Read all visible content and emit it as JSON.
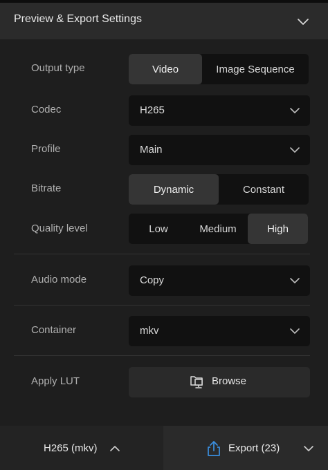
{
  "header": {
    "title": "Preview & Export Settings",
    "chevron_icon": "chevron-down-icon"
  },
  "settings": {
    "output_type": {
      "label": "Output type",
      "options": [
        "Video",
        "Image Sequence"
      ],
      "selected": "Video"
    },
    "codec": {
      "label": "Codec",
      "value": "H265"
    },
    "profile": {
      "label": "Profile",
      "value": "Main"
    },
    "bitrate": {
      "label": "Bitrate",
      "options": [
        "Dynamic",
        "Constant"
      ],
      "selected": "Dynamic"
    },
    "quality_level": {
      "label": "Quality level",
      "options": [
        "Low",
        "Medium",
        "High"
      ],
      "selected": "High"
    },
    "audio_mode": {
      "label": "Audio mode",
      "value": "Copy"
    },
    "container": {
      "label": "Container",
      "value": "mkv"
    },
    "apply_lut": {
      "label": "Apply LUT",
      "button_label": "Browse",
      "icon": "folder-monitor-icon"
    }
  },
  "footer": {
    "format_summary": "H265 (mkv)",
    "format_chevron_icon": "chevron-up-icon",
    "export_label": "Export (23)",
    "export_icon": "share-export-icon",
    "export_menu_icon": "chevron-down-icon"
  },
  "colors": {
    "accent_blue": "#3b8fe0",
    "panel_bg": "#1e1e1e",
    "control_bg": "#111111",
    "active_segment": "#353535"
  }
}
